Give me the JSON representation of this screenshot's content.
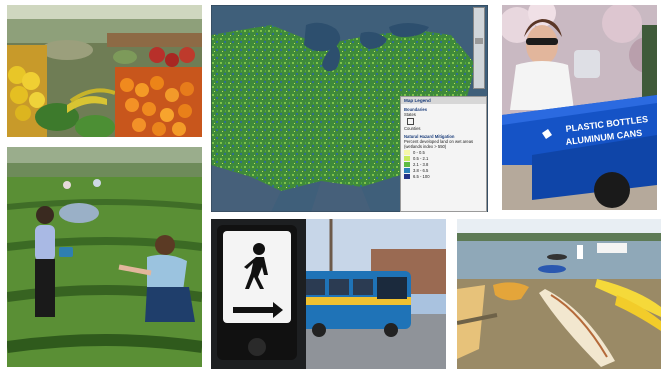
{
  "map_legend": {
    "title": "Map Legend",
    "boundaries_heading": "Boundaries",
    "boundaries_sub": "States",
    "counties_label": "Counties",
    "mitigation_heading": "Natural Hazard Mitigation",
    "description": "Percent developed land on wet areas (wetlands index > 550)",
    "classes": [
      {
        "label": "0 - 0.5",
        "color": "#f6f7a8"
      },
      {
        "label": "0.5 - 2.1",
        "color": "#c8ea5c"
      },
      {
        "label": "2.1 - 3.8",
        "color": "#5dbb43"
      },
      {
        "label": "3.8 - 6.5",
        "color": "#2c7fb8"
      },
      {
        "label": "6.5 - 100",
        "color": "#243488"
      }
    ]
  },
  "recycling_bin": {
    "line1": "PLASTIC BOTTLES",
    "line2": "ALUMINUM CANS"
  }
}
